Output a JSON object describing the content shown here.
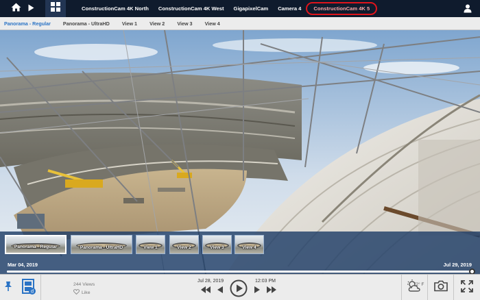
{
  "topbar": {
    "camera_tabs": [
      {
        "label": "ConstructionCam 4K North"
      },
      {
        "label": "ConstructionCam 4K West"
      },
      {
        "label": "GigapixelCam"
      },
      {
        "label": "Camera 4"
      },
      {
        "label": "ConstructionCam 4K 5"
      }
    ],
    "active_tab_index": 4,
    "active_highlight_color": "#e0141b"
  },
  "subtabs": {
    "items": [
      {
        "label": "Panorama - Regular"
      },
      {
        "label": "Panorama - UltraHD"
      },
      {
        "label": "View 1"
      },
      {
        "label": "View 2"
      },
      {
        "label": "View 3"
      },
      {
        "label": "View 4"
      }
    ],
    "active_index": 0,
    "active_color": "#2a73c5"
  },
  "thumbnails": {
    "items": [
      {
        "label": "Panorama - Regular"
      },
      {
        "label": "Panorama - UltraHD"
      },
      {
        "label": "View 1"
      },
      {
        "label": "View 2"
      },
      {
        "label": "View 3"
      },
      {
        "label": "View 4"
      }
    ],
    "active_index": 0
  },
  "timeline": {
    "start_date": "Mar 04, 2019",
    "end_date": "Jul 29, 2019",
    "progress": 1.0
  },
  "bottom": {
    "views": "244 Views",
    "like": "Like",
    "current_date": "Jul 28, 2019",
    "current_time": "12:03 PM",
    "temperature": "72° F"
  },
  "icons": {
    "home": "home-icon",
    "play": "play-icon",
    "grid": "grid-icon",
    "user": "user-icon",
    "pin": "pin-icon",
    "film": "film-icon",
    "heart": "heart-icon",
    "skip_back": "skip-back-icon",
    "step_back": "step-back-icon",
    "play_circle": "play-circle-icon",
    "step_forward": "step-forward-icon",
    "skip_forward": "skip-forward-icon",
    "weather": "weather-icon",
    "camera": "camera-icon",
    "fullscreen": "fullscreen-icon"
  }
}
